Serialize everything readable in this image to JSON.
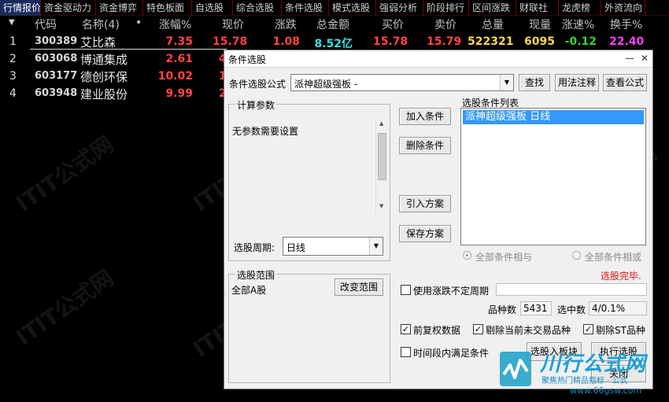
{
  "tabs": [
    "行情报价",
    "资金驱动力",
    "资金博弈",
    "特色板面",
    "自选股",
    "综合选股",
    "条件选股",
    "模式选股",
    "强弱分析",
    "阶段排行",
    "区间涨跌",
    "财联社",
    "龙虎榜",
    "外资流向"
  ],
  "table": {
    "headers": {
      "code": "代码",
      "name": "名称(4)",
      "dot": "•",
      "pct": "涨幅%",
      "price": "现价",
      "chg": "涨跌",
      "amount": "总金额",
      "bid": "买价",
      "ask": "卖价",
      "vol": "总量",
      "cur": "现量",
      "speed": "涨速%",
      "turnover": "换手%"
    },
    "rows": [
      {
        "idx": "1",
        "code": "300389",
        "name": "艾比森",
        "pct": "7.35",
        "price": "15.78",
        "chg": "1.08",
        "amount": "8.52亿",
        "bid": "15.78",
        "ask": "15.79",
        "vol": "522321",
        "cur": "6095",
        "speed": "-0.12",
        "turnover": "22.40"
      },
      {
        "idx": "2",
        "code": "603068",
        "name": "博通集成",
        "pct": "2.61",
        "price": "4"
      },
      {
        "idx": "3",
        "code": "603177",
        "name": "德创环保",
        "pct": "10.02",
        "price": "1"
      },
      {
        "idx": "4",
        "code": "603948",
        "name": "建业股份",
        "pct": "9.99",
        "price": "2"
      }
    ]
  },
  "dialog": {
    "title": "条件选股",
    "minimize": "—",
    "close": "✕",
    "formula_label": "条件选股公式",
    "formula_value": "派神超级强板  -",
    "find": "查找",
    "usage": "用法注释",
    "view_formula": "查看公式",
    "params_group": "计算参数",
    "params_text": "无参数需要设置",
    "period_label": "选股周期:",
    "period_value": "日线",
    "add_condition": "加入条件",
    "delete_condition": "删除条件",
    "import_plan": "引入方案",
    "save_plan": "保存方案",
    "cond_list_label": "选股条件列表",
    "cond_list_items": [
      "派神超级强板  日线"
    ],
    "radio_and": "全部条件相与",
    "radio_or": "全部条件相或",
    "status": "选股完毕.",
    "range_group": "选股范围",
    "range_value": "全部A股",
    "change_range": "改变范围",
    "use_pct_period": "使用涨跌不定周期",
    "count_label": "品种数",
    "count_value": "5431",
    "selected_label": "选中数",
    "selected_value": "4/0.1%",
    "forward_adj": "前复权数据",
    "exclude_untraded": "剔除当前未交易品种",
    "exclude_st": "剔除ST品种",
    "time_period": "时间段内满足条件",
    "to_board": "选股入板块",
    "execute": "执行选股",
    "close_btn": "关闭"
  },
  "watermark": {
    "text": "ITIT公式网"
  },
  "logo": {
    "main": "川行公式网",
    "sub": "聚焦热门精品指标 · 公式",
    "url": "www.66gsw.com"
  },
  "colors": {
    "red": "#ff4444",
    "yellow": "#ffd84a",
    "cyan": "#38e0e0",
    "green": "#3ad03a",
    "magenta": "#ff40ff",
    "select": "#3399ff"
  }
}
